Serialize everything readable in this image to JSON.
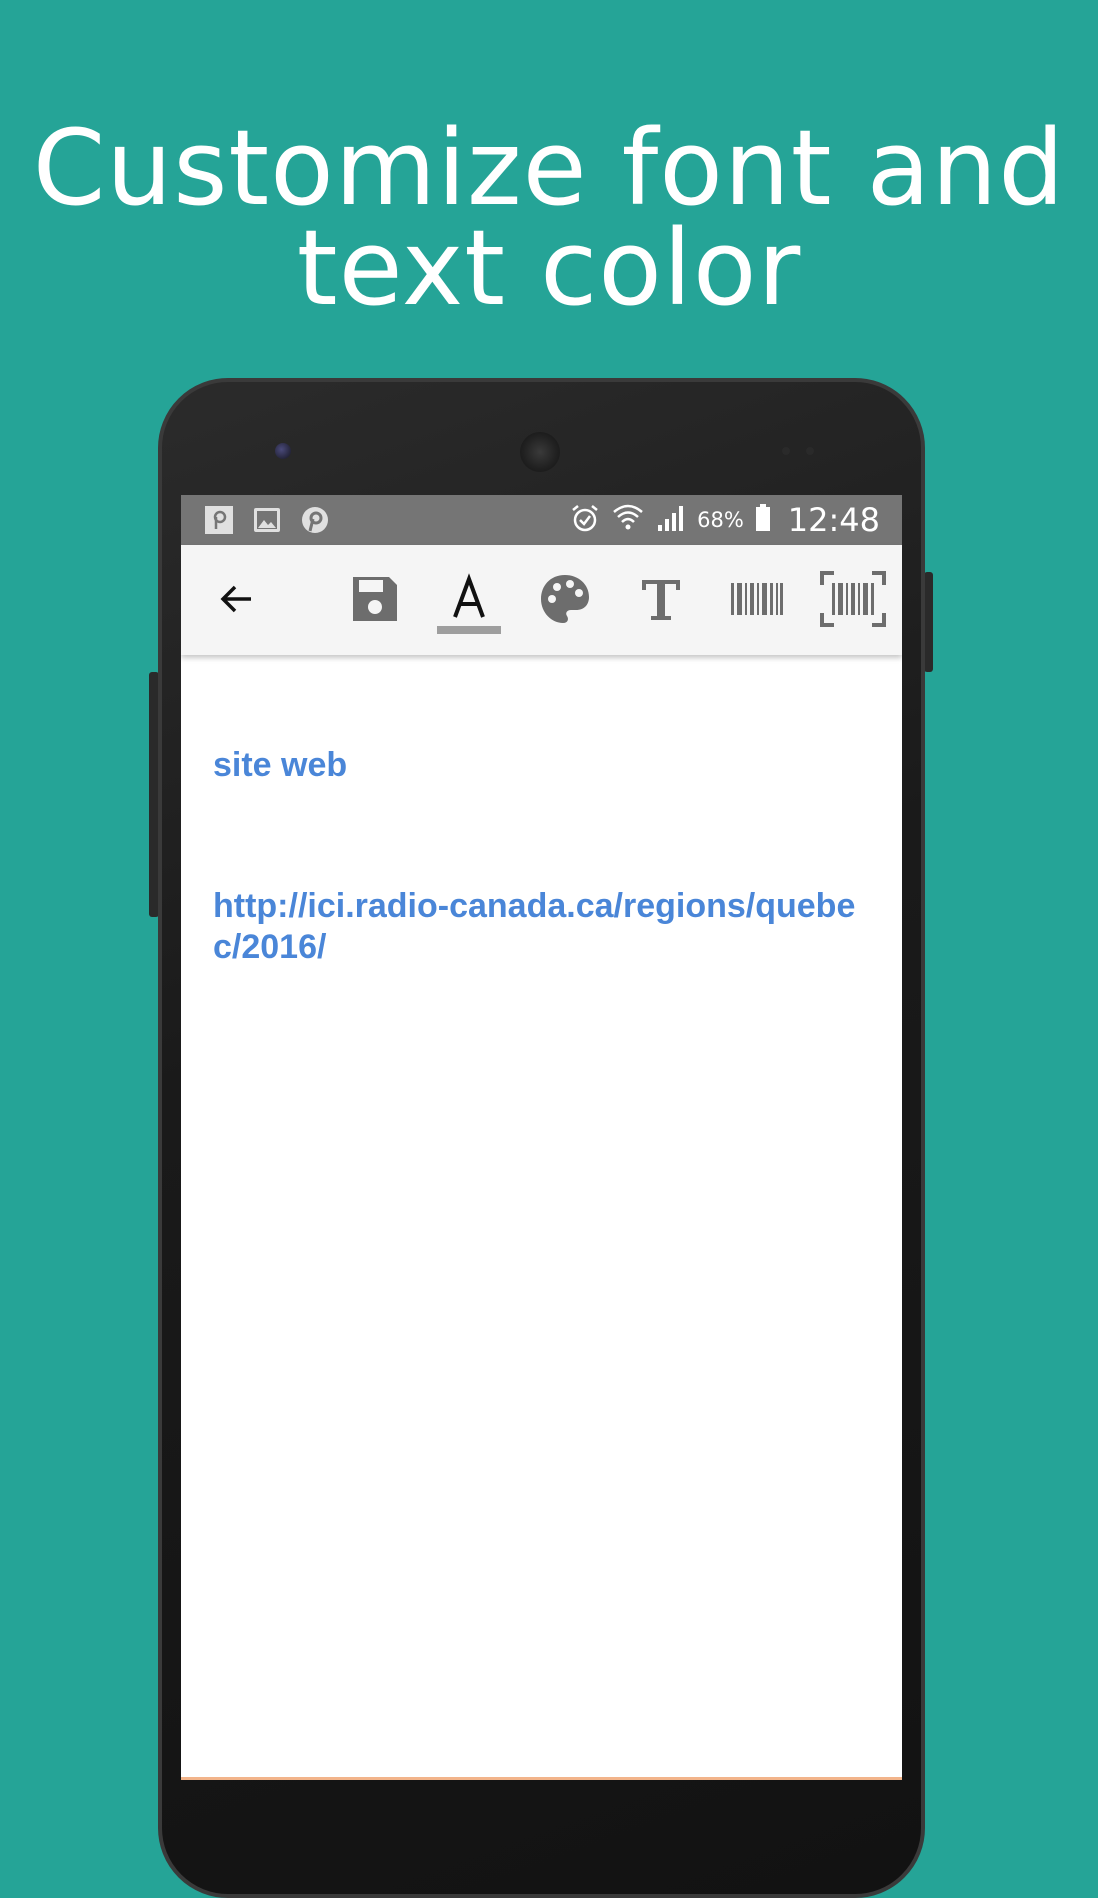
{
  "headline": {
    "line1": "Customize font and",
    "line2": "text color"
  },
  "status_bar": {
    "battery": "68%",
    "time": "12:48",
    "notification_icons": [
      "pinterest-p-icon",
      "image-icon",
      "pinterest-icon"
    ],
    "system_icons": [
      "alarm-icon",
      "wifi-icon",
      "signal-icon",
      "battery-icon"
    ]
  },
  "toolbar": {
    "icons": [
      "back-arrow-icon",
      "save-icon",
      "text-font-icon",
      "palette-icon",
      "text-style-icon",
      "barcode-icon",
      "barcode-scan-icon"
    ],
    "active": "text-font-icon"
  },
  "document": {
    "line1": "site web",
    "line2": "http://ici.radio-canada.ca/regions/quebec/2016/",
    "text_color": "#4a86d8"
  },
  "colors": {
    "background": "#25a497",
    "status_bar": "#757575",
    "toolbar": "#f5f5f5",
    "icon": "#6d6d6d"
  }
}
